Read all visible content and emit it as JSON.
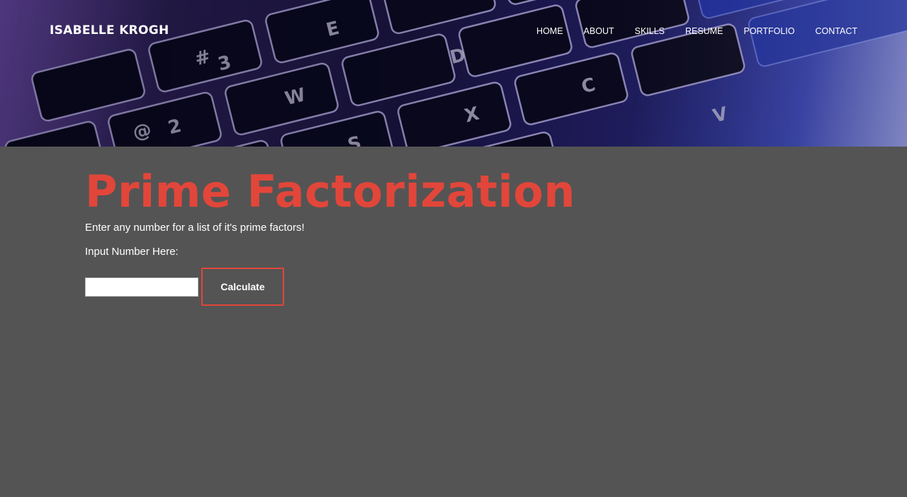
{
  "header": {
    "brand": "ISABELLE KROGH",
    "nav": [
      {
        "label": "HOME"
      },
      {
        "label": "ABOUT"
      },
      {
        "label": "SKILLS"
      },
      {
        "label": "RESUME"
      },
      {
        "label": "PORTFOLIO"
      },
      {
        "label": "CONTACT"
      }
    ]
  },
  "hero": {
    "keycaps": [
      "#",
      "3",
      "E",
      "D",
      "C",
      "V",
      "2",
      "W",
      "S",
      "X",
      "@"
    ]
  },
  "main": {
    "title": "Prime Factorization",
    "intro": "Enter any number for a list of it's prime factors!",
    "input_label": "Input Number Here:",
    "input_value": "",
    "input_placeholder": "",
    "button_label": "Calculate"
  },
  "colors": {
    "accent": "#e2463a",
    "background": "#545454",
    "text": "#ffffff"
  }
}
